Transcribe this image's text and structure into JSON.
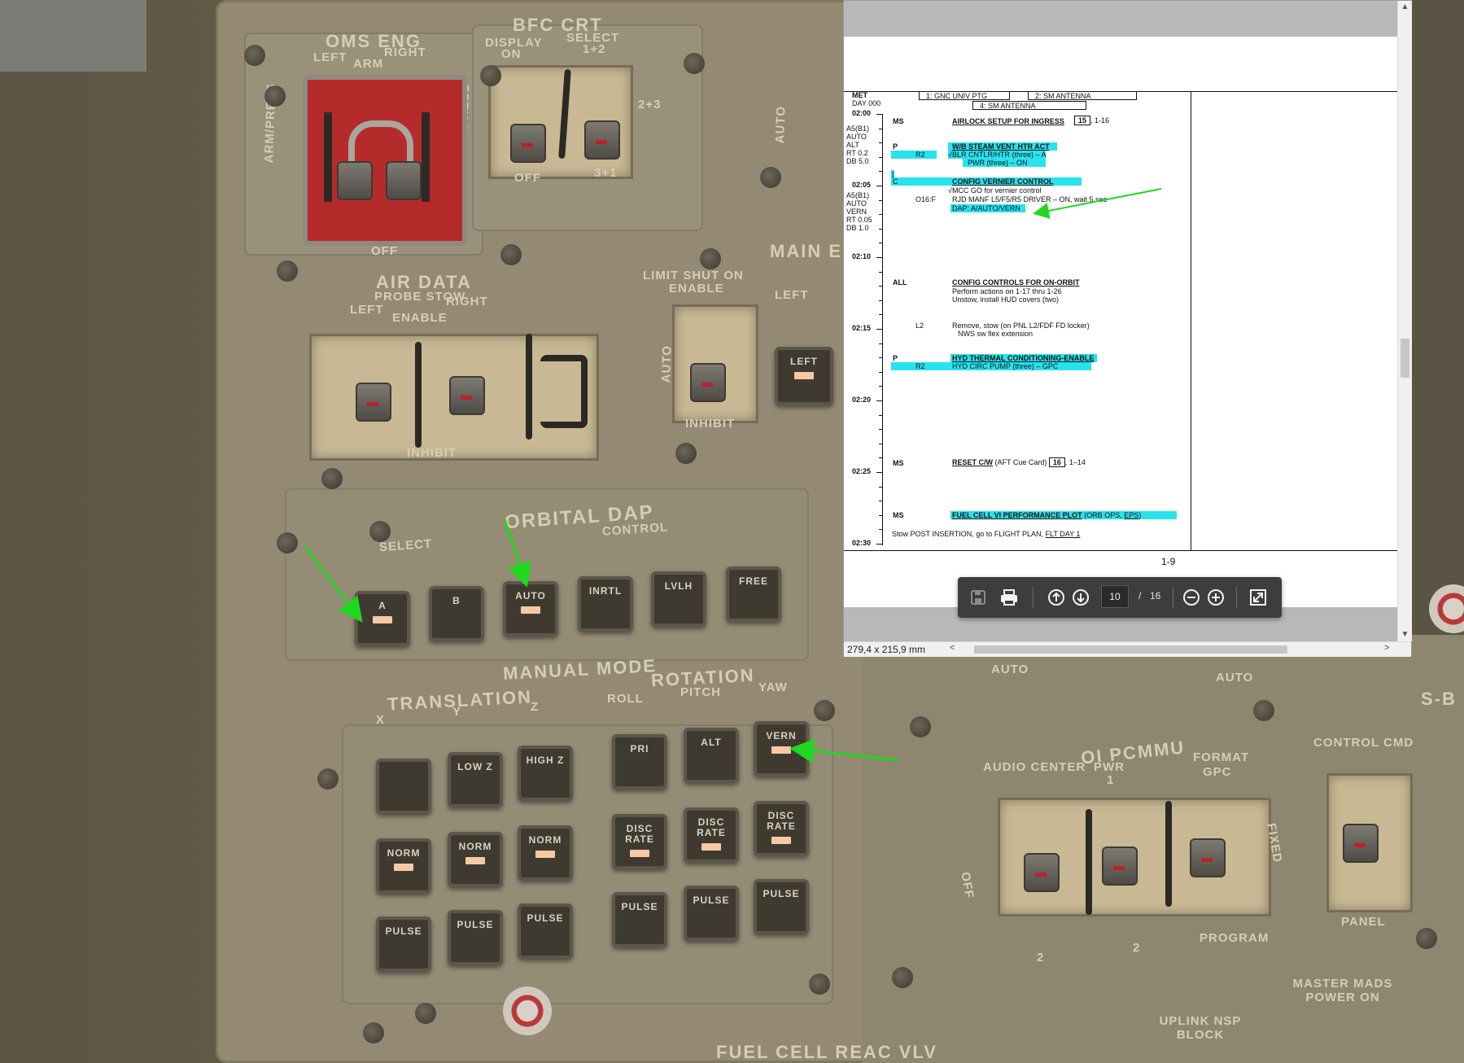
{
  "cockpit": {
    "oms_eng": {
      "title": "OMS ENG",
      "left": "LEFT",
      "arm": "ARM",
      "right": "RIGHT",
      "arm_press_left": "ARM/PRESS",
      "arm_press_right": "ARM/PRESS",
      "off": "OFF"
    },
    "bfc_crt": {
      "title": "BFC CRT",
      "display": "DISPLAY",
      "on": "ON",
      "select": "SELECT",
      "select_12": "1+2",
      "pos_23": "2+3",
      "pos_31": "3+1",
      "off": "OFF"
    },
    "air_data": {
      "title": "AIR DATA",
      "subtitle": "PROBE STOW",
      "left": "LEFT",
      "right": "RIGHT",
      "enable": "ENABLE",
      "inhibit": "INHIBIT"
    },
    "main_eng": {
      "title": "MAIN EN",
      "limit": "LIMIT SHUT ON",
      "enable": "ENABLE",
      "left": "LEFT",
      "auto": "AUTO",
      "inhibit": "INHIBIT",
      "left_button": "LEFT"
    },
    "auto_side": "AUTO",
    "orbital_dap": {
      "title": "ORBITAL DAP",
      "select": "SELECT",
      "control": "CONTROL",
      "buttons": [
        {
          "label": "A",
          "lit": true
        },
        {
          "label": "B",
          "lit": false
        },
        {
          "label": "AUTO",
          "lit": true
        },
        {
          "label": "INRTL",
          "lit": false
        },
        {
          "label": "LVLH",
          "lit": false
        },
        {
          "label": "FREE",
          "lit": false
        }
      ]
    },
    "manual_mode": {
      "title": "MANUAL MODE",
      "translation": "TRANSLATION",
      "rotation": "ROTATION",
      "x": "X",
      "y": "Y",
      "z": "Z",
      "roll": "ROLL",
      "pitch": "PITCH",
      "yaw": "YAW",
      "row1": [
        {
          "label": "",
          "lit": false
        },
        {
          "label": "LOW Z",
          "lit": false
        },
        {
          "label": "HIGH Z",
          "lit": false
        },
        {
          "label": "PRI",
          "lit": false
        },
        {
          "label": "ALT",
          "lit": false
        },
        {
          "label": "VERN",
          "lit": true
        }
      ],
      "row2": [
        {
          "label": "NORM",
          "lit": true
        },
        {
          "label": "NORM",
          "lit": true
        },
        {
          "label": "NORM",
          "lit": true
        },
        {
          "label": "DISC RATE",
          "lit": true
        },
        {
          "label": "DISC RATE",
          "lit": true
        },
        {
          "label": "DISC RATE",
          "lit": true
        }
      ],
      "row3": [
        {
          "label": "PULSE",
          "lit": false
        },
        {
          "label": "PULSE",
          "lit": false
        },
        {
          "label": "PULSE",
          "lit": false
        },
        {
          "label": "PULSE",
          "lit": false
        },
        {
          "label": "PULSE",
          "lit": false
        },
        {
          "label": "PULSE",
          "lit": false
        }
      ]
    },
    "oi_pcmmu": {
      "title": "OI PCMMU",
      "audio_center": "AUDIO CENTER",
      "pwr": "PWR",
      "format": "FORMAT",
      "gpc": "GPC",
      "fixed": "FIXED",
      "off": "OFF",
      "one": "1",
      "two_a": "2",
      "two_b": "2",
      "program": "PROGRAM"
    },
    "control_cmd": {
      "title": "CONTROL CMD",
      "panel": "PANEL"
    },
    "auto_bottom_a": "AUTO",
    "auto_bottom_b": "AUTO",
    "sb": "S-B",
    "master_mads": "MASTER MADS POWER ON",
    "uplink": "UPLINK NSP BLOCK",
    "fuel_cell": "FUEL CELL REAC VLV"
  },
  "pdf": {
    "header": {
      "met": "MET",
      "day": "DAY 000",
      "col1": "1:  GNC UNIV PTG",
      "col2": "2:  SM ANTENNA",
      "col4": "4:  SM ANTENNA"
    },
    "times": [
      "02:00",
      "02:05",
      "02:10",
      "02:15",
      "02:20",
      "02:25",
      "02:30"
    ],
    "side_notes": [
      "A5(B1)",
      "AUTO",
      "ALT",
      "RT 0.2",
      "DB 5.0"
    ],
    "side_notes2": [
      "A5(B1)",
      "AUTO",
      "VERN",
      "RT 0.05",
      "DB 1.0"
    ],
    "entries": {
      "ms1": "MS",
      "airlock": "AIRLOCK SETUP FOR INGRESS",
      "airlock_box": "15",
      "airlock_ref": ", 1-16",
      "p1": "P",
      "wb": "W/B STEAM VENT HTR ACT",
      "r2a": "R2",
      "blr": "√BLR CNTLR/HTR (three) – A",
      "pwr": "PWR (three) – ON",
      "pipe": "|",
      "c": "C",
      "config_vern": "CONFIG VERNIER CONTROL",
      "mcc": "√MCC GO for vernier control",
      "o16": "O16:F",
      "rjd": "RJD MANF L5/F5/R5 DRIVER – ON, wait 5 sec",
      "dap": "DAP:  A/AUTO/VERN",
      "all": "ALL",
      "config_orbit": "CONFIG CONTROLS FOR ON-ORBIT",
      "perform": "Perform actions on 1-17 thru 1-26",
      "unstow": "Unstow, install HUD covers (two)",
      "l2": "L2",
      "remove": "Remove, stow (on PNL L2/FDF FD locker)",
      "nws": "NWS sw flex extension",
      "p2": "P",
      "hyd": "HYD THERMAL CONDITIONING-ENABLE",
      "r2b": "R2",
      "hydcirc": "HYD CIRC PUMP (three) – GPC",
      "ms2": "MS",
      "reset": "RESET C/W",
      "reset_rest": " (AFT Cue Card) ",
      "reset_box": "16",
      "reset_ref": ", 1–14",
      "ms3": "MS",
      "fuel": "FUEL CELL VI PERFORMANCE PLOT",
      "fuel_rest": " (ORB OPS, ",
      "eps": "EPS",
      "close": ")",
      "stow": "Stow POST INSERTION, go to FLIGHT PLAN, ",
      "flt": "FLT DAY 1"
    },
    "page_label": "1-9",
    "toolbar": {
      "page": "10",
      "sep": "/",
      "total": "16"
    },
    "dims": "279,4 x 215,9 mm",
    "highlight_color": "#27e3ee"
  },
  "colors": {
    "arrow": "#1fd81f",
    "lamp": "#f6c9a4",
    "panel": "#948a74"
  }
}
